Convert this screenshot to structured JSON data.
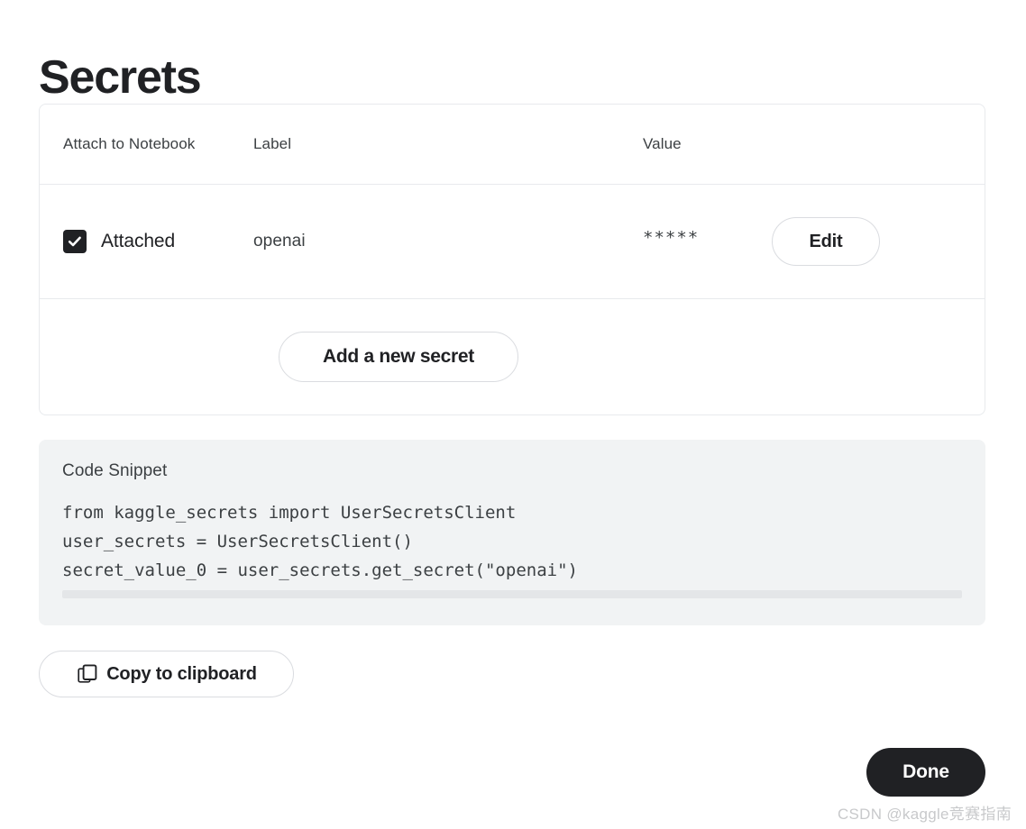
{
  "page": {
    "title": "Secrets"
  },
  "table": {
    "headers": {
      "attach": "Attach to Notebook",
      "label": "Label",
      "value": "Value"
    },
    "rows": [
      {
        "attached_label": "Attached",
        "attached_checked": true,
        "label": "openai",
        "value_masked": "*****",
        "edit_label": "Edit"
      }
    ],
    "add_button_label": "Add a new secret"
  },
  "code_snippet": {
    "title": "Code Snippet",
    "lines": [
      "from kaggle_secrets import UserSecretsClient",
      "user_secrets = UserSecretsClient()",
      "secret_value_0 = user_secrets.get_secret(\"openai\")"
    ],
    "text": "from kaggle_secrets import UserSecretsClient\nuser_secrets = UserSecretsClient()\nsecret_value_0 = user_secrets.get_secret(\"openai\")"
  },
  "actions": {
    "copy_label": "Copy to clipboard",
    "done_label": "Done"
  },
  "watermark": {
    "text": "CSDN @kaggle竞赛指南"
  },
  "colors": {
    "text_primary": "#202124",
    "text_secondary": "#3c4043",
    "border": "#e8eaed",
    "button_border": "#dadce0",
    "panel_bg": "#f1f3f4",
    "scrollbar": "#e4e6e8",
    "done_bg": "#202124",
    "watermark": "#c8c9cb"
  }
}
